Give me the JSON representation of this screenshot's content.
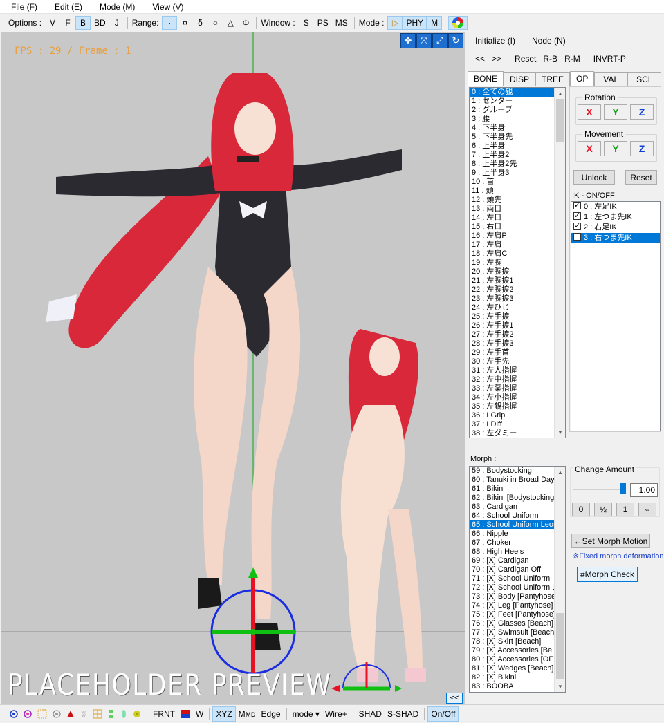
{
  "menu": [
    "File (F)",
    "Edit (E)",
    "Mode (M)",
    "View (V)"
  ],
  "toolbar": {
    "options_label": "Options :",
    "options": [
      "V",
      "F",
      "B",
      "BD",
      "J"
    ],
    "options_active": "B",
    "range_label": "Range:",
    "range": [
      "·",
      "¤",
      "δ",
      "○",
      "△",
      "Φ"
    ],
    "window_label": "Window :",
    "window": [
      "S",
      "PS",
      "MS"
    ],
    "mode_label": "Mode :",
    "mode": [
      "▷",
      "PHY",
      "M"
    ]
  },
  "viewport": {
    "fps_text": "FPS : 29 / Frame : 1",
    "placeholder": "PLACEHOLDER PREVIEW",
    "icons": [
      "move-xy-icon",
      "move-all-icon",
      "move-z-icon",
      "rotate-icon"
    ]
  },
  "right_panel": {
    "top_buttons": [
      "Initialize (I)",
      "Node (N)"
    ],
    "nav_buttons": [
      "<<",
      ">>",
      "Reset",
      "R-B",
      "R-M",
      "INVRT-P"
    ],
    "tabs": [
      "BONE",
      "DISP",
      "TREE"
    ],
    "op_tabs": [
      "OP",
      "VAL",
      "SCL"
    ],
    "rotation_label": "Rotation",
    "movement_label": "Movement",
    "axes": [
      "X",
      "Y",
      "Z"
    ],
    "unlock_label": "Unlock",
    "reset_label": "Reset",
    "ik_label": "IK - ON/OFF",
    "ik_items": [
      "0 : 左足IK",
      "1 : 左つま先IK",
      "2 : 右足IK",
      "3 : 右つま先IK"
    ],
    "bones": [
      "0 : 全ての親",
      "1 : センター",
      "2 : グルーブ",
      "3 : 腰",
      "4 : 下半身",
      "5 : 下半身先",
      "6 : 上半身",
      "7 : 上半身2",
      "8 : 上半身2先",
      "9 : 上半身3",
      "10 : 首",
      "11 : 頭",
      "12 : 頭先",
      "13 : 両目",
      "14 : 左目",
      "15 : 右目",
      "16 : 左肩P",
      "17 : 左肩",
      "18 : 左肩C",
      "19 : 左腕",
      "20 : 左腕捩",
      "21 : 左腕捩1",
      "22 : 左腕捩2",
      "23 : 左腕捩3",
      "24 : 左ひじ",
      "25 : 左手捩",
      "26 : 左手捩1",
      "27 : 左手捩2",
      "28 : 左手捩3",
      "29 : 左手首",
      "30 : 左手先",
      "31 : 左人指握",
      "32 : 左中指握",
      "33 : 左薬指握",
      "34 : 左小指握",
      "35 : 左親指握",
      "36 : LGrip",
      "37 : LDiff",
      "38 : 左ダミー"
    ],
    "morph_label": "Morph :",
    "morphs": [
      "59 : Bodystocking",
      "60 : Tanuki in Broad Day",
      "61 : Bikini",
      "62 : Bikini [Bodystocking]",
      "63 : Cardigan",
      "64 : School Uniform",
      "65 : School Uniform Leot",
      "66 : Nipple",
      "67 : Choker",
      "68 : High Heels",
      "69 : [X] Cardigan",
      "70 : [X] Cardigan Off",
      "71 : [X] School Uniform",
      "72 : [X] School Uniform L",
      "73 : [X] Body [Pantyhose",
      "74 : [X] Leg [Pantyhose]",
      "75 : [X] Feet [Pantyhose]",
      "76 : [X] Glasses [Beach]",
      "77 : [X] Swimsuit [Beach]",
      "78 : [X] Skirt [Beach]",
      "79 : [X] Accessories [Be",
      "80 : [X] Accessories [OF",
      "81 : [X] Wedges [Beach]",
      "82 : [X] Bikini",
      "83 : BOOBA"
    ],
    "change_amount_label": "Change Amount",
    "change_amount_value": "1.00",
    "change_amount_level": 1.0,
    "amount_buttons": [
      "0",
      "½",
      "1",
      "⇔"
    ],
    "set_morph_label": "←Set Morph Motion",
    "fixed_morph_label": "※Fixed morph deformation",
    "morph_check_label": "#Morph Check",
    "collapse_label": "<<"
  },
  "statusbar": {
    "items": [
      "FRNT",
      "W",
      "XYZ",
      "Mᴍᴅ",
      "Edge",
      "mode ▾",
      "Wire+",
      "SHAD",
      "S-SHAD",
      "On/Off"
    ],
    "active": [
      "XYZ",
      "On/Off"
    ]
  },
  "colors": {
    "axis_x": "#e81123",
    "axis_y": "#16a016",
    "axis_z": "#0f3fd0",
    "selection": "#0078d7",
    "fps": "#e8a040"
  }
}
